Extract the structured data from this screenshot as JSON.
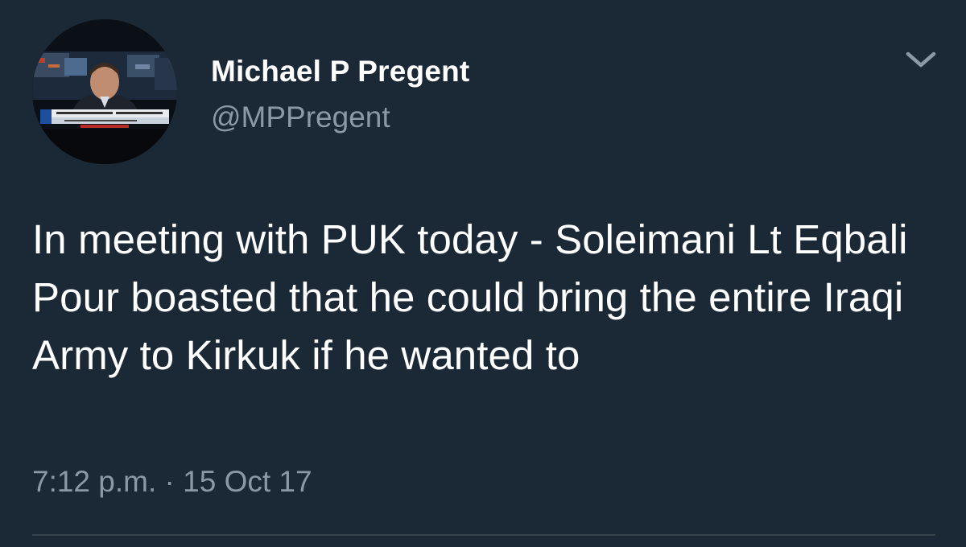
{
  "tweet": {
    "author": {
      "name": "Michael P Pregent",
      "handle": "@MPPregent"
    },
    "text": "In meeting with PUK today - Soleimani Lt Eqbali Pour boasted that he could bring the entire Iraqi Army to Kirkuk if he wanted to",
    "timestamp": "7:12 p.m. · 15 Oct 17"
  },
  "icons": {
    "menu": "chevron-down-icon"
  },
  "colors": {
    "background": "#1b2836",
    "primary_text": "#ffffff",
    "secondary_text": "#8b98a5",
    "divider": "#38444d"
  }
}
